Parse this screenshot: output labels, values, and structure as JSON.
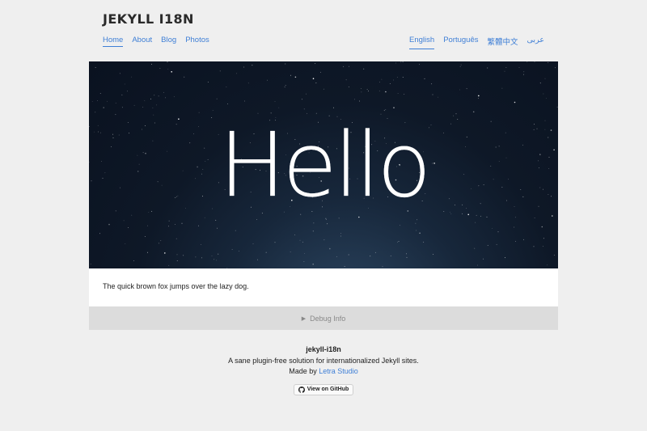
{
  "site": {
    "title": "JEKYLL I18N"
  },
  "nav": {
    "main": [
      {
        "label": "Home",
        "active": true
      },
      {
        "label": "About",
        "active": false
      },
      {
        "label": "Blog",
        "active": false
      },
      {
        "label": "Photos",
        "active": false
      }
    ],
    "languages": [
      {
        "label": "English",
        "active": true
      },
      {
        "label": "Português",
        "active": false
      },
      {
        "label": "繁體中文",
        "active": false
      },
      {
        "label": "عربى",
        "active": false
      }
    ]
  },
  "hero": {
    "heading": "Hello"
  },
  "content": {
    "text": "The quick brown fox jumps over the lazy dog."
  },
  "debug": {
    "label": "Debug Info"
  },
  "footer": {
    "name": "jekyll-i18n",
    "tagline": "A sane plugin-free solution for internationalized Jekyll sites.",
    "made_by_prefix": "Made by",
    "made_by_link": "Letra Studio",
    "github_button": "View on GitHub"
  }
}
